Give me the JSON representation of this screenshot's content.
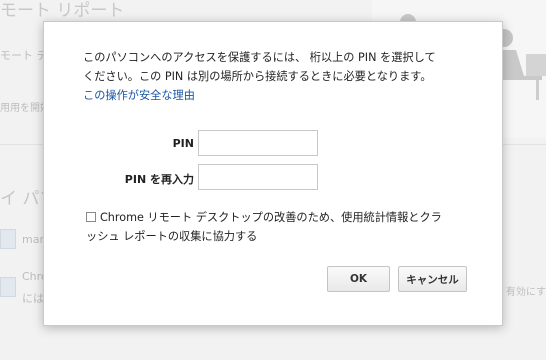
{
  "background": {
    "title": "モート リポート",
    "subtitle": "モート デ",
    "start_button": "用用を開始",
    "section_heading": "イ パソ",
    "rows": [
      {
        "text": "mar"
      },
      {
        "text": "Chro",
        "text2": "には"
      }
    ],
    "row_action": "有効にす"
  },
  "dialog": {
    "message_line1": "このパソコンへのアクセスを保護するには、 桁以上の PIN を選択して",
    "message_line2": "ください。この PIN は別の場所から接続するときに必要となります。",
    "why_link": "この操作が安全な理由",
    "pin_label": "PIN",
    "pin_value": "",
    "pin_confirm_label": "PIN を再入力",
    "pin_confirm_value": "",
    "consent_line1": "Chrome リモート デスクトップの改善のため、使用統計情報とクラ",
    "consent_line2": "ッシュ レポートの収集に協力する",
    "ok_label": "OK",
    "cancel_label": "キャンセル"
  },
  "colors": {
    "link": "#1a55a6",
    "overlay": "#f2f2f2"
  }
}
